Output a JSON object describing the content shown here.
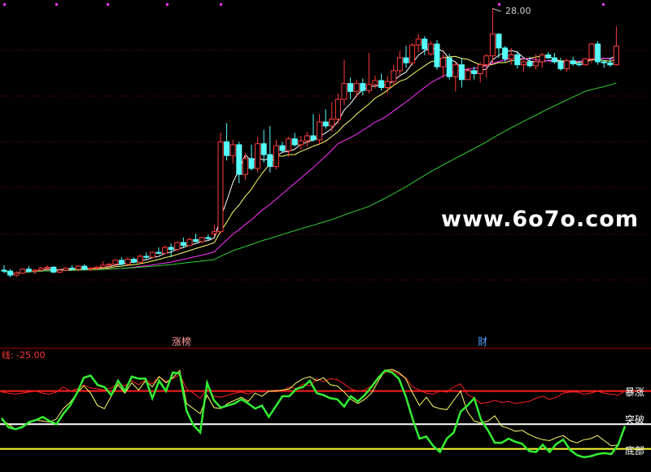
{
  "watermark": "www.6o7o.com",
  "colors": {
    "background": "#000000",
    "up": "#ff3b3b",
    "down": "#55ffff",
    "ma_white": "#ffffff",
    "ma_yellow": "#ffff66",
    "ma_magenta": "#ff33ff",
    "ma_green": "#33cc33",
    "grid": "#8a0000",
    "osc_red": "#ff2020",
    "osc_green": "#33ee33",
    "osc_yellow": "#ffff66",
    "label_blue": "#4fa6ff"
  },
  "chart_data": [
    {
      "type": "candlestick",
      "high_marker": "28.00",
      "ylim": [
        0,
        30
      ],
      "grid": true,
      "candles": [
        [
          3.3,
          3.8,
          3.0,
          3.2
        ],
        [
          3.2,
          3.4,
          2.6,
          2.8
        ],
        [
          2.8,
          3.2,
          2.6,
          3.0
        ],
        [
          3.0,
          3.5,
          2.9,
          3.4
        ],
        [
          3.4,
          3.7,
          3.1,
          3.2
        ],
        [
          3.2,
          3.4,
          2.9,
          3.3
        ],
        [
          3.3,
          3.6,
          3.2,
          3.5
        ],
        [
          3.5,
          3.8,
          3.3,
          3.6
        ],
        [
          3.6,
          3.7,
          3.0,
          3.1
        ],
        [
          3.1,
          3.4,
          3.0,
          3.3
        ],
        [
          3.3,
          3.6,
          3.2,
          3.5
        ],
        [
          3.5,
          3.8,
          3.3,
          3.4
        ],
        [
          3.4,
          3.8,
          3.2,
          3.7
        ],
        [
          3.7,
          3.9,
          3.3,
          3.4
        ],
        [
          3.4,
          3.6,
          3.2,
          3.5
        ],
        [
          3.5,
          3.7,
          3.3,
          3.6
        ],
        [
          3.6,
          4.2,
          3.5,
          3.8
        ],
        [
          3.8,
          4.0,
          3.5,
          3.9
        ],
        [
          3.9,
          4.4,
          3.7,
          4.3
        ],
        [
          4.3,
          4.6,
          3.8,
          3.9
        ],
        [
          3.9,
          4.6,
          3.8,
          4.4
        ],
        [
          4.4,
          4.6,
          4.0,
          4.1
        ],
        [
          4.1,
          4.9,
          4.0,
          4.7
        ],
        [
          4.7,
          5.1,
          4.4,
          4.6
        ],
        [
          4.6,
          5.2,
          4.5,
          5.1
        ],
        [
          5.1,
          5.6,
          4.9,
          5.0
        ],
        [
          5.0,
          5.8,
          4.9,
          5.6
        ],
        [
          5.6,
          6.0,
          4.6,
          5.4
        ],
        [
          5.4,
          6.2,
          5.2,
          6.1
        ],
        [
          6.1,
          6.6,
          5.6,
          5.8
        ],
        [
          5.8,
          6.6,
          5.7,
          6.4
        ],
        [
          6.4,
          7.0,
          6.1,
          6.2
        ],
        [
          6.2,
          6.7,
          6.0,
          6.6
        ],
        [
          6.6,
          6.9,
          6.3,
          6.5
        ],
        [
          7.0,
          7.9,
          6.7,
          7.2
        ],
        [
          7.2,
          17.2,
          7.0,
          16.3
        ],
        [
          16.3,
          18.2,
          14.4,
          14.9
        ],
        [
          14.9,
          16.5,
          14.1,
          16.0
        ],
        [
          16.0,
          16.3,
          12.1,
          13.0
        ],
        [
          13.0,
          15.2,
          12.4,
          14.6
        ],
        [
          14.6,
          16.0,
          13.4,
          13.6
        ],
        [
          13.6,
          16.8,
          13.2,
          16.1
        ],
        [
          16.1,
          17.5,
          14.2,
          15.0
        ],
        [
          15.0,
          17.9,
          13.2,
          13.8
        ],
        [
          13.8,
          16.5,
          13.5,
          15.9
        ],
        [
          15.9,
          16.3,
          15.2,
          15.4
        ],
        [
          15.4,
          16.8,
          14.8,
          16.6
        ],
        [
          16.6,
          17.2,
          15.8,
          16.0
        ],
        [
          16.0,
          16.9,
          15.5,
          16.4
        ],
        [
          16.4,
          17.3,
          15.8,
          16.9
        ],
        [
          16.9,
          19.1,
          16.3,
          16.5
        ],
        [
          16.5,
          19.1,
          16.0,
          18.3
        ],
        [
          18.3,
          19.6,
          17.6,
          17.9
        ],
        [
          17.9,
          20.3,
          17.3,
          18.6
        ],
        [
          18.6,
          21.2,
          18.1,
          20.6
        ],
        [
          20.6,
          24.6,
          20.0,
          22.2
        ],
        [
          22.2,
          22.8,
          20.6,
          21.4
        ],
        [
          21.4,
          22.6,
          20.8,
          22.2
        ],
        [
          22.2,
          22.7,
          21.0,
          21.5
        ],
        [
          21.5,
          25.3,
          21.2,
          22.1
        ],
        [
          22.1,
          23.0,
          21.7,
          22.5
        ],
        [
          22.5,
          23.2,
          21.5,
          21.8
        ],
        [
          21.8,
          23.0,
          21.2,
          22.4
        ],
        [
          22.4,
          24.1,
          22.0,
          23.5
        ],
        [
          23.5,
          25.5,
          23.0,
          24.8
        ],
        [
          24.8,
          26.0,
          23.8,
          24.3
        ],
        [
          24.3,
          26.3,
          24.0,
          26.1
        ],
        [
          26.1,
          27.2,
          25.4,
          26.7
        ],
        [
          26.7,
          27.0,
          25.1,
          25.7
        ],
        [
          25.2,
          26.5,
          25.0,
          26.2
        ],
        [
          26.2,
          26.6,
          23.6,
          23.9
        ],
        [
          23.9,
          25.2,
          22.8,
          24.8
        ],
        [
          24.8,
          25.2,
          22.6,
          22.9
        ],
        [
          22.9,
          24.3,
          21.4,
          24.1
        ],
        [
          24.1,
          24.8,
          21.8,
          22.6
        ],
        [
          22.6,
          23.8,
          22.6,
          23.5
        ],
        [
          23.5,
          23.9,
          22.6,
          23.2
        ],
        [
          23.2,
          24.4,
          22.3,
          24.1
        ],
        [
          24.1,
          25.2,
          22.8,
          25.0
        ],
        [
          25.0,
          29.8,
          24.3,
          27.2
        ],
        [
          27.2,
          27.3,
          24.8,
          25.8
        ],
        [
          25.8,
          26.0,
          24.4,
          24.7
        ],
        [
          24.7,
          25.8,
          24.1,
          25.1
        ],
        [
          25.1,
          25.5,
          23.7,
          24.1
        ],
        [
          24.1,
          24.6,
          23.4,
          24.4
        ],
        [
          24.4,
          24.9,
          23.8,
          24.0
        ],
        [
          24.0,
          25.2,
          23.6,
          24.4
        ],
        [
          24.4,
          25.3,
          23.8,
          25.1
        ],
        [
          25.1,
          25.4,
          24.7,
          24.8
        ],
        [
          24.8,
          25.3,
          24.2,
          24.4
        ],
        [
          24.4,
          24.8,
          23.5,
          23.7
        ],
        [
          23.7,
          24.7,
          23.4,
          24.5
        ],
        [
          24.5,
          24.9,
          24.0,
          24.2
        ],
        [
          24.2,
          24.5,
          23.9,
          24.1
        ],
        [
          24.1,
          24.8,
          24.0,
          24.7
        ],
        [
          24.7,
          26.3,
          24.3,
          26.2
        ],
        [
          26.2,
          26.5,
          24.1,
          24.4
        ],
        [
          24.4,
          24.6,
          23.8,
          24.3
        ],
        [
          24.3,
          24.8,
          23.9,
          24.1
        ],
        [
          24.1,
          28.0,
          24.0,
          26.0
        ]
      ]
    },
    {
      "type": "line",
      "name_label": "线: -25.00",
      "ylim": [
        0,
        100
      ],
      "levels": [
        {
          "label": "暴涨",
          "value": 72,
          "color": "#ff2020"
        },
        {
          "label": "突破",
          "value": 40,
          "color": "#ffffff"
        },
        {
          "label": "底部",
          "value": 16,
          "color": "#ffff33"
        }
      ],
      "series": [
        {
          "color": "#ff2020",
          "values": [
            71,
            70,
            69,
            70,
            71,
            72,
            70,
            69,
            71,
            76,
            72,
            74,
            78,
            75,
            74,
            73,
            75,
            79,
            77,
            82,
            78,
            83,
            79,
            86,
            81,
            84,
            88,
            74,
            70,
            65,
            74,
            67,
            66,
            68,
            70,
            71,
            69,
            72,
            71,
            72,
            73,
            72,
            76,
            74,
            79,
            77,
            84,
            81,
            84,
            83,
            79,
            74,
            72,
            73,
            77,
            86,
            90,
            92,
            88,
            85,
            76,
            73,
            70,
            69,
            72,
            71,
            76,
            79,
            69,
            65,
            60,
            61,
            63,
            61,
            62,
            60,
            61,
            62,
            65,
            67,
            64,
            66,
            70,
            71,
            71,
            69,
            70,
            72,
            70,
            69,
            68,
            72
          ]
        },
        {
          "color": "#ffff66",
          "values": [
            44,
            40,
            35,
            38,
            41,
            44,
            43,
            42,
            45,
            55,
            61,
            70,
            77,
            70,
            58,
            55,
            67,
            78,
            70,
            80,
            73,
            82,
            76,
            86,
            80,
            85,
            92,
            60,
            55,
            50,
            68,
            56,
            55,
            60,
            63,
            66,
            62,
            70,
            67,
            72,
            72,
            73,
            74,
            80,
            84,
            86,
            82,
            85,
            78,
            77,
            71,
            64,
            60,
            64,
            70,
            82,
            92,
            93,
            90,
            84,
            70,
            58,
            66,
            57,
            55,
            54,
            63,
            72,
            52,
            43,
            41,
            43,
            48,
            38,
            36,
            33,
            34,
            30,
            27,
            25,
            24,
            27,
            29,
            24,
            22,
            25,
            26,
            29,
            24,
            19,
            20,
            38
          ]
        },
        {
          "color": "#33ee33",
          "values": [
            46,
            37,
            35,
            37,
            42,
            44,
            47,
            43,
            40,
            50,
            58,
            70,
            85,
            87,
            78,
            76,
            68,
            82,
            72,
            86,
            84,
            84,
            65,
            82,
            72,
            90,
            89,
            53,
            39,
            32,
            80,
            63,
            56,
            58,
            60,
            64,
            60,
            55,
            58,
            47,
            57,
            67,
            67,
            74,
            76,
            82,
            70,
            68,
            65,
            64,
            57,
            67,
            62,
            68,
            76,
            85,
            92,
            90,
            84,
            67,
            45,
            26,
            28,
            19,
            13,
            26,
            32,
            52,
            58,
            65,
            44,
            34,
            22,
            22,
            26,
            23,
            21,
            14,
            13,
            20,
            13,
            21,
            25,
            15,
            10,
            8,
            9,
            11,
            12,
            11,
            20,
            38
          ]
        }
      ]
    }
  ],
  "tags": {
    "limit_up": "涨榜",
    "finance": "财"
  }
}
